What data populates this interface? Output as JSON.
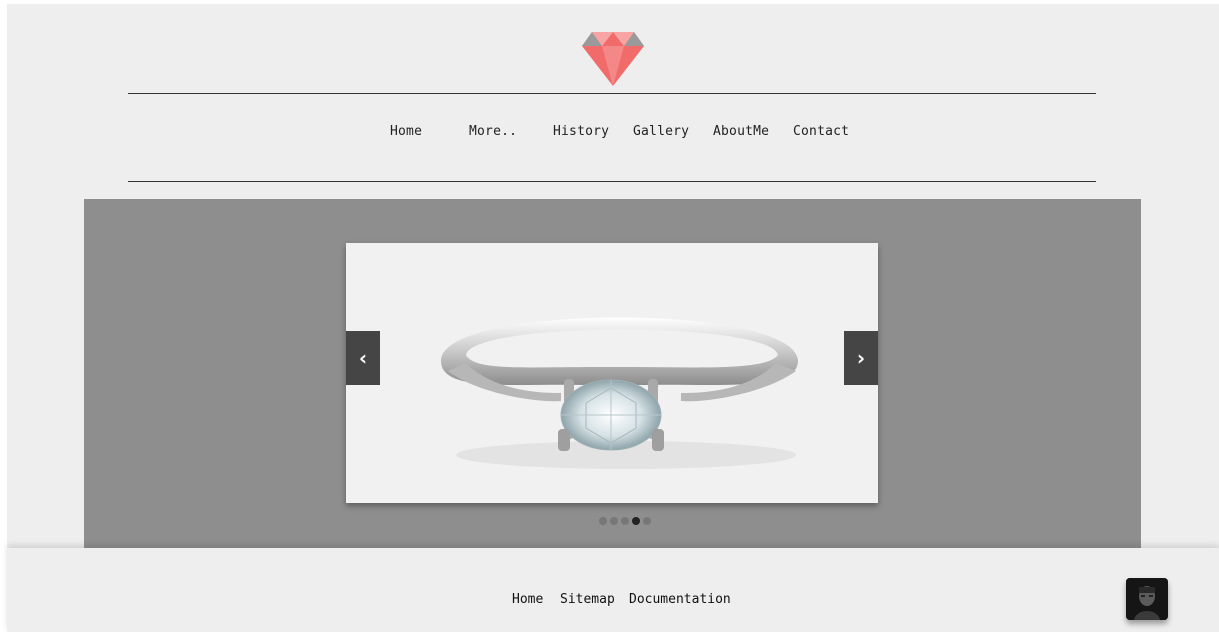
{
  "brand": {
    "logo_icon": "diamond-icon",
    "colors": {
      "primary": "#f26b6b",
      "secondary": "#9a9a9a"
    }
  },
  "nav": {
    "items": [
      {
        "label": "Home"
      },
      {
        "label": "More.."
      },
      {
        "label": "History"
      },
      {
        "label": "Gallery"
      },
      {
        "label": "AboutMe"
      },
      {
        "label": "Contact"
      }
    ]
  },
  "slider": {
    "image_subject": "diamond solitaire ring",
    "prev_icon": "chevron-left-icon",
    "next_icon": "chevron-right-icon",
    "prev_glyph": "‹",
    "next_glyph": "›",
    "slide_count": 5,
    "active_index": 3
  },
  "footer": {
    "links": [
      {
        "label": "Home"
      },
      {
        "label": "Sitemap"
      },
      {
        "label": "Documentation"
      }
    ],
    "avatar_icon": "avatar"
  }
}
